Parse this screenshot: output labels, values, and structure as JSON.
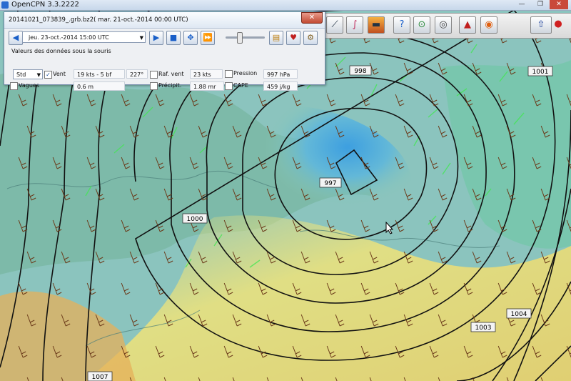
{
  "window": {
    "title": "OpenCPN 3.3.2222",
    "minimize": "—",
    "restore": "❐",
    "close": "✕"
  },
  "grib": {
    "file": "20141021_073839_.grb.bz2( mar. 21-oct.-2014 00:00  UTC)",
    "close": "✕",
    "date": "jeu. 23-oct.-2014 15:00  UTC",
    "section": "Valeurs des données sous la souris",
    "std": "Std",
    "wind": {
      "label": "Vent",
      "value": "19 kts -  5 bf",
      "dir": "227°",
      "checked": true
    },
    "gust": {
      "label": "Raf. vent",
      "value": "23 kts"
    },
    "pressure": {
      "label": "Pression",
      "value": "997 hPa"
    },
    "waves": {
      "label": "Vagues",
      "value": "0.6 m"
    },
    "precip": {
      "label": "Précipit.",
      "value": "1.88 mr"
    },
    "cape": {
      "label": "CAPE",
      "value": "459 j/kg"
    }
  },
  "isobars": [
    "998",
    "1001",
    "997",
    "1000",
    "1004",
    "1003",
    "1007"
  ],
  "colors": {
    "sea_blue": "#3d9fe0",
    "land_green": "#7ec89a",
    "yellow": "#efe37a",
    "wind_green": "#40e850",
    "isobar": "#111111",
    "arrow": "#6b3a1a"
  }
}
